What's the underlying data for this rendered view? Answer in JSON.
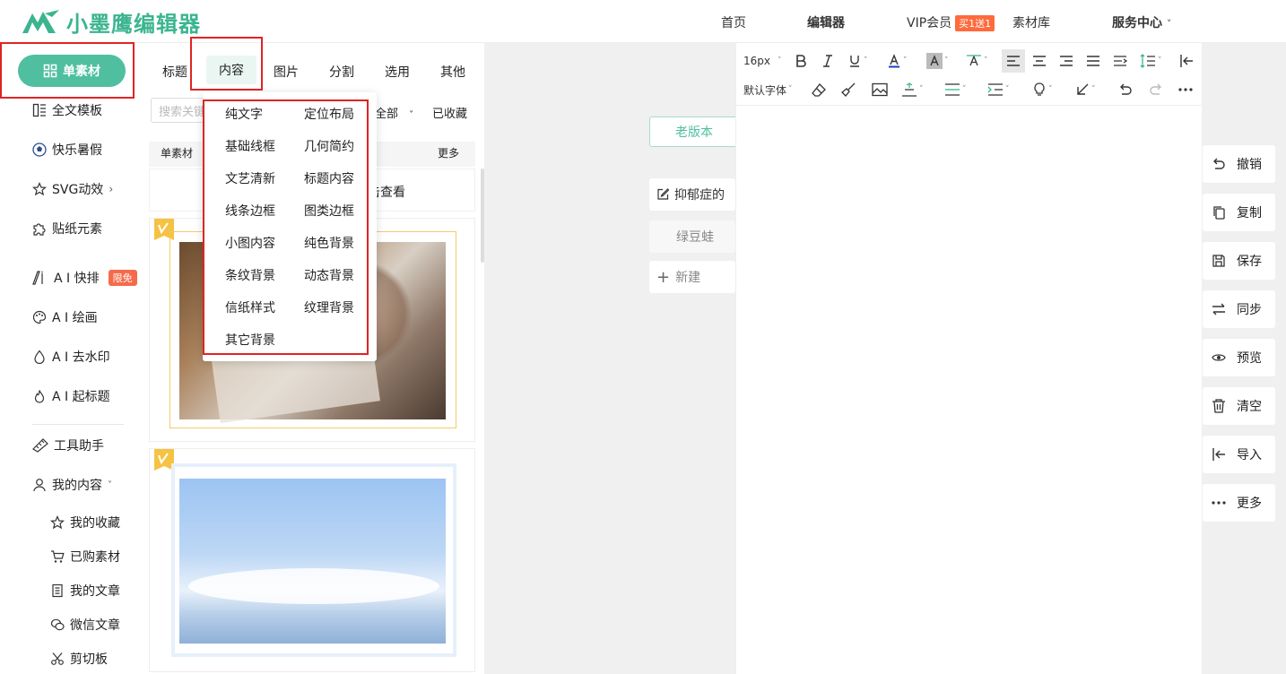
{
  "header": {
    "logo_text": "小墨鹰编辑器",
    "nav": [
      "首页",
      "编辑器",
      "VIP会员",
      "素材库",
      "服务中心"
    ],
    "vip_badge": "买1送1",
    "service_caret": "˅"
  },
  "sidebar": {
    "active": "单素材",
    "items": [
      "全文模板",
      "快乐暑假",
      "SVG动效",
      "贴纸元素",
      "A I 快排",
      "A I 绘画",
      "A I 去水印",
      "A I 起标题",
      "工具助手",
      "我的内容"
    ],
    "ai_badge": "限免",
    "sub_items": [
      "我的收藏",
      "已购素材",
      "我的文章",
      "微信文章",
      "剪切板"
    ]
  },
  "panel": {
    "tabs": [
      "标题",
      "内容",
      "图片",
      "分割",
      "选用",
      "其他"
    ],
    "search_placeholder": "搜索关键词",
    "filter_all": "全部",
    "favorites": "已收藏",
    "row_label": "单素材",
    "more": "更多",
    "view_hint": "击查看",
    "dropdown_items": [
      "纯文字",
      "定位布局",
      "基础线框",
      "几何简约",
      "文艺清新",
      "标题内容",
      "线条边框",
      "图类边框",
      "小图内容",
      "纯色背景",
      "条纹背景",
      "动态背景",
      "信纸样式",
      "纹理背景",
      "其它背景"
    ]
  },
  "docs": {
    "old_version": "老版本",
    "items": [
      "抑郁症的",
      "绿豆蛙",
      "新建"
    ]
  },
  "editor": {
    "font_size": "16px",
    "font_family": "默认字体"
  },
  "right_actions": [
    "撤销",
    "复制",
    "保存",
    "同步",
    "预览",
    "清空",
    "导入",
    "更多"
  ],
  "colors": {
    "brand": "#3bb58f",
    "active_green": "#4fbf9f",
    "highlight_red": "#e02424"
  }
}
